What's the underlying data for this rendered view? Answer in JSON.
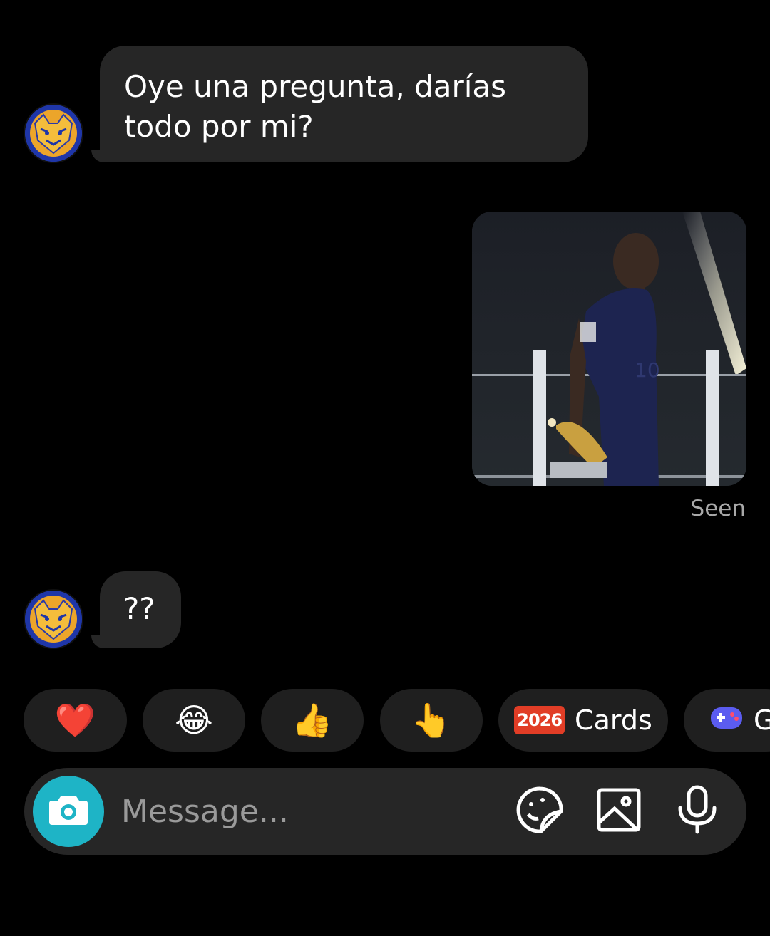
{
  "messages": {
    "first_text": "Oye una pregunta, darías todo por mi?",
    "second_text": "??",
    "seen_label": "Seen"
  },
  "quick_replies": [
    {
      "icon": "heart-emoji",
      "glyph": "❤️"
    },
    {
      "icon": "laughing-emoji",
      "glyph": "😂"
    },
    {
      "icon": "thumbs-up-emoji",
      "glyph": "👍"
    },
    {
      "icon": "pointing-hand-emoji",
      "glyph": "👆"
    },
    {
      "icon": "cards-2026-icon",
      "badge": "2026",
      "label": "Cards"
    },
    {
      "icon": "game-controller-icon",
      "label": "G"
    }
  ],
  "composer": {
    "placeholder": "Message..."
  },
  "colors": {
    "background": "#000000",
    "bubble": "#262626",
    "camera_button": "#1eb4c6",
    "chip": "#1f1f1f",
    "seen_text": "#a8a8a8"
  }
}
